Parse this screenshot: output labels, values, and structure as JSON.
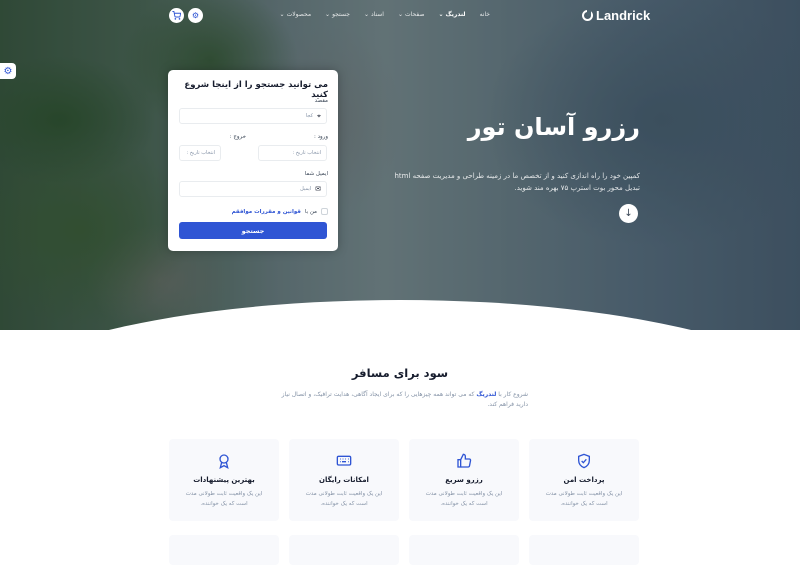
{
  "brand": {
    "logo_text": "Landrick"
  },
  "nav": {
    "items": [
      {
        "label": "خانه",
        "active": false,
        "dropdown": false
      },
      {
        "label": "لندریگ",
        "active": true,
        "dropdown": true
      },
      {
        "label": "صفحات",
        "active": false,
        "dropdown": true
      },
      {
        "label": "اسناد",
        "active": false,
        "dropdown": true
      },
      {
        "label": "جستجو",
        "active": false,
        "dropdown": true
      },
      {
        "label": "محصولات",
        "active": false,
        "dropdown": true
      }
    ],
    "icons": [
      "settings-icon",
      "cart-icon"
    ]
  },
  "hero": {
    "title": "رزرو آسان تور",
    "description": "کمپین خود را راه اندازی کنید و از تخصص ما در زمینه طراحی و مدیریت صفحه html تبدیل محور بوت استرپ ۷۵ بهره مند شوید."
  },
  "search_card": {
    "heading": "می توانید جستجو را از اینجا شروع کنید",
    "destination": {
      "label": "مقصد",
      "placeholder": "کجا"
    },
    "checkin": {
      "label": "ورود :",
      "placeholder": "انتخاب تاریخ :"
    },
    "checkout": {
      "label": "خروج :",
      "placeholder": "انتخاب تاریخ :"
    },
    "email": {
      "label": "ایمیل شما",
      "placeholder": "ایمیل"
    },
    "agree_prefix": "من با",
    "agree_link": "قوانین و مقررات موافقم",
    "submit_label": "جستجو"
  },
  "benefits": {
    "title": "سود برای مسافر",
    "subtitle_prefix": "شروع کار با",
    "subtitle_brand": "لندریگ",
    "subtitle_rest": "که می تواند همه چیزهایی را که برای ایجاد آگاهی، هدایت ترافیک، و اتصال نیاز دارید فراهم کند.",
    "features": [
      {
        "title": "پرداخت امن",
        "desc": "این یک واقعیت ثابت طولانی مدت است که یک خواننده.",
        "icon": "shield-check-icon"
      },
      {
        "title": "رزرو سریع",
        "desc": "این یک واقعیت ثابت طولانی مدت است که یک خواننده.",
        "icon": "thumbs-up-icon"
      },
      {
        "title": "امکانات رایگان",
        "desc": "این یک واقعیت ثابت طولانی مدت است که یک خواننده.",
        "icon": "keyboard-icon"
      },
      {
        "title": "بهترین پیشنهادات",
        "desc": "این یک واقعیت ثابت طولانی مدت است که یک خواننده.",
        "icon": "award-icon"
      }
    ]
  },
  "colors": {
    "primary": "#2f55d4",
    "heading": "#161c2d",
    "muted": "#8492a6"
  }
}
